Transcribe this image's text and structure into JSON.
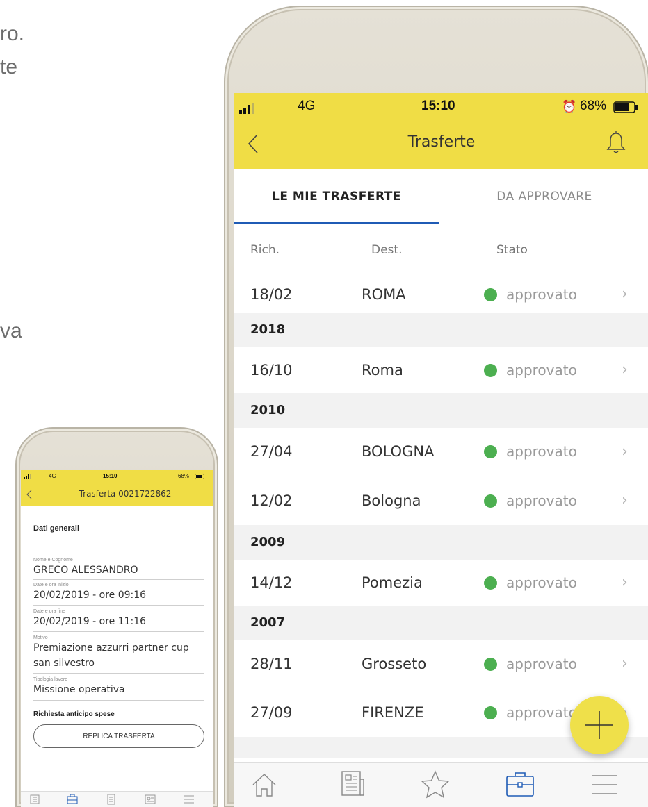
{
  "background": {
    "fragments": [
      "ro.",
      "te",
      "va"
    ]
  },
  "main_app": {
    "status": {
      "signal": "4G",
      "time": "15:10",
      "battery": "68%"
    },
    "title": "Trasferte",
    "tabs": [
      "LE MIE TRASFERTE",
      "DA APPROVARE"
    ],
    "active_tab": 0,
    "columns": [
      "Rich.",
      "Dest.",
      "Stato"
    ],
    "entries": [
      {
        "type": "row",
        "date": "18/02",
        "dest": "ROMA",
        "stato": "approvato"
      },
      {
        "type": "year",
        "label": "2018"
      },
      {
        "type": "row",
        "date": "16/10",
        "dest": "Roma",
        "stato": "approvato"
      },
      {
        "type": "year",
        "label": "2010"
      },
      {
        "type": "row",
        "date": "27/04",
        "dest": "BOLOGNA",
        "stato": "approvato"
      },
      {
        "type": "row",
        "date": "12/02",
        "dest": "Bologna",
        "stato": "approvato"
      },
      {
        "type": "year",
        "label": "2009"
      },
      {
        "type": "row",
        "date": "14/12",
        "dest": "Pomezia",
        "stato": "approvato"
      },
      {
        "type": "year",
        "label": "2007"
      },
      {
        "type": "row",
        "date": "28/11",
        "dest": "Grosseto",
        "stato": "approvato"
      },
      {
        "type": "row",
        "date": "27/09",
        "dest": "FIRENZE",
        "stato": "approvato"
      }
    ],
    "bottom_icons": [
      "home-icon",
      "news-icon",
      "star-icon",
      "briefcase-icon",
      "menu-icon"
    ],
    "active_bottom": 3,
    "accent": "#f0dd45",
    "tab_underline": "#1f5bb5",
    "status_ok": "#4caf50"
  },
  "detail_app": {
    "status": {
      "signal": "4G",
      "time": "15:10",
      "battery": "68%"
    },
    "title": "Trasferta 0021722862",
    "section_general": "Dati generali",
    "fields": [
      {
        "label": "Nome e Cognome",
        "value": "GRECO ALESSANDRO"
      },
      {
        "label": "Date e ora inizio",
        "value": "20/02/2019 - ore 09:16"
      },
      {
        "label": "Date e ora fine",
        "value": "20/02/2019 - ore 11:16"
      },
      {
        "label": "Motivo",
        "value": "Premiazione azzurri partner cup",
        "value2": "san silvestro"
      },
      {
        "label": "Tipologia lavoro",
        "value": "Missione operativa"
      }
    ],
    "section_advance": "Richiesta anticipo spese",
    "replica_button": "REPLICA TRASFERTA",
    "bottom_icons": [
      "building-icon",
      "briefcase-icon",
      "document-icon",
      "contact-card-icon",
      "menu-icon"
    ],
    "active_bottom": 1
  }
}
